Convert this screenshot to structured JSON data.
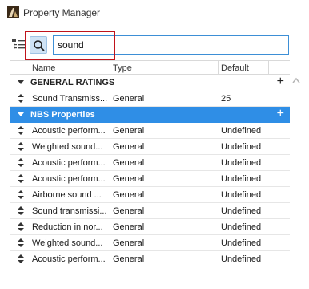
{
  "window": {
    "title": "Property Manager"
  },
  "toolbar": {
    "search_value": "sound"
  },
  "table": {
    "columns": [
      "Name",
      "Type",
      "Default"
    ],
    "groups": [
      {
        "label": "GENERAL RATINGS",
        "rows": [
          {
            "name": "Sound Transmiss...",
            "type": "General",
            "default": "25"
          }
        ]
      },
      {
        "label": "NBS Properties",
        "rows": [
          {
            "name": "Acoustic perform...",
            "type": "General",
            "default": "Undefined"
          },
          {
            "name": "Weighted sound...",
            "type": "General",
            "default": "Undefined"
          },
          {
            "name": "Acoustic perform...",
            "type": "General",
            "default": "Undefined"
          },
          {
            "name": "Acoustic perform...",
            "type": "General",
            "default": "Undefined"
          },
          {
            "name": "Airborne sound ...",
            "type": "General",
            "default": "Undefined"
          },
          {
            "name": "Sound transmissi...",
            "type": "General",
            "default": "Undefined"
          },
          {
            "name": "Reduction in nor...",
            "type": "General",
            "default": "Undefined"
          },
          {
            "name": "Weighted sound...",
            "type": "General",
            "default": "Undefined"
          },
          {
            "name": "Acoustic perform...",
            "type": "General",
            "default": "Undefined"
          }
        ]
      }
    ]
  },
  "colors": {
    "selected_group": "#2f8ee6",
    "search_focus": "#3d8fd6",
    "highlight": "#c0131b"
  }
}
